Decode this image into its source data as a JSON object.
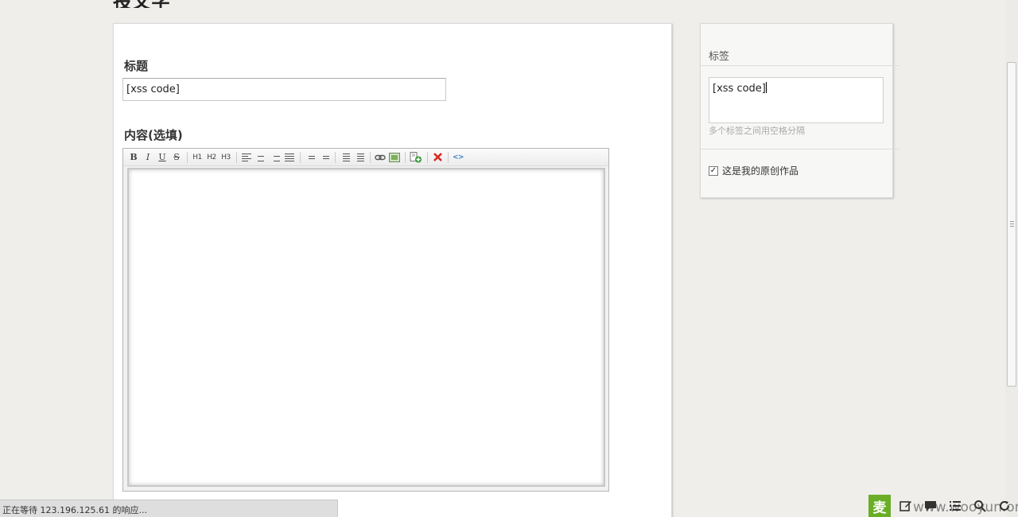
{
  "page": {
    "title": "投文字"
  },
  "form": {
    "title_label": "标题",
    "title_value": "[xss code]",
    "content_label": "内容(选填)"
  },
  "toolbar": {
    "bold": "B",
    "italic": "I",
    "underline": "U",
    "strike": "S",
    "h1": "H1",
    "h2": "H2",
    "h3": "H3",
    "code": "<>"
  },
  "sidebar": {
    "tags_heading": "标签",
    "tags_value": "[xss code]",
    "tags_hint": "多个标签之间用空格分隔",
    "original_checked": true,
    "original_label": "这是我的原创作品"
  },
  "status": {
    "text": "正在等待 123.196.125.61 的响应..."
  },
  "floatbar": {
    "main_label": "麦"
  },
  "watermark": {
    "text": "www.wooyun.org"
  },
  "colors": {
    "accent_green": "#6aad26",
    "delete_red": "#d9271f",
    "link_blue": "#3a7fc4"
  }
}
